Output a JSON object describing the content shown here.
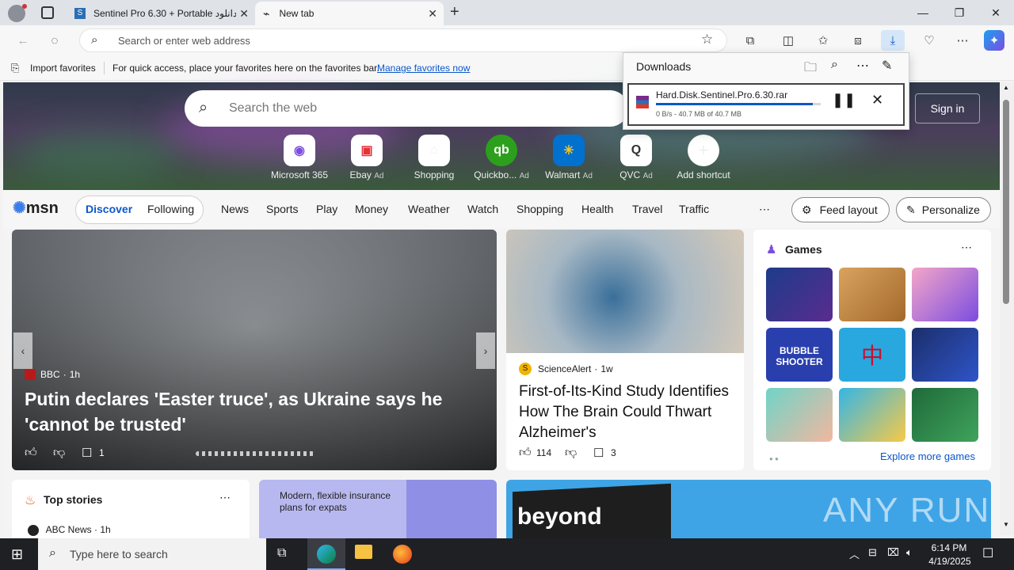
{
  "tabs": [
    {
      "label": "Sentinel Pro 6.30 + Portable دانلود",
      "active": false
    },
    {
      "label": "New tab",
      "active": true
    }
  ],
  "address": {
    "placeholder": "Search or enter web address"
  },
  "favorites_bar": {
    "import_label": "Import favorites",
    "message": "For quick access, place your favorites here on the favorites bar.",
    "manage_link": "Manage favorites now"
  },
  "downloads": {
    "title": "Downloads",
    "file_name": "Hard.Disk.Sentinel.Pro.6.30.rar",
    "status": "0 B/s - 40.7 MB of 40.7 MB",
    "progress": 0.95
  },
  "search": {
    "placeholder": "Search the web"
  },
  "signin_label": "Sign in",
  "shortcuts": [
    {
      "label": "Microsoft 365",
      "ad": ""
    },
    {
      "label": "Ebay",
      "ad": "Ad"
    },
    {
      "label": "Shopping",
      "ad": ""
    },
    {
      "label": "Quickbo...",
      "ad": "Ad"
    },
    {
      "label": "Walmart",
      "ad": "Ad"
    },
    {
      "label": "QVC",
      "ad": "Ad"
    },
    {
      "label": "Add shortcut",
      "ad": ""
    }
  ],
  "msn": {
    "logo": "msn",
    "tabs": [
      "Discover",
      "Following"
    ],
    "nav": [
      "News",
      "Sports",
      "Play",
      "Money",
      "Weather",
      "Watch",
      "Shopping",
      "Health",
      "Travel",
      "Traffic"
    ],
    "more": "⋯",
    "feed_layout": "Feed layout",
    "personalize": "Personalize"
  },
  "hero_story": {
    "source": "BBC",
    "time": "1h",
    "headline": "Putin declares 'Easter truce', as Ukraine says he 'cannot be trusted'",
    "comments": "1"
  },
  "science_story": {
    "source": "ScienceAlert",
    "time": "1w",
    "headline": "First-of-Its-Kind Study Identifies How The Brain Could Thwart Alzheimer's",
    "likes": "114",
    "comments": "3"
  },
  "games": {
    "title": "Games",
    "explore": "Explore more games",
    "tiles": [
      "jewel",
      "wood",
      "makeup",
      "BUBBLE SHOOTER",
      "mahjong",
      "blocks",
      "doctor",
      "crazy",
      "solitaire"
    ]
  },
  "top_stories": {
    "title": "Top stories",
    "source": "ABC News",
    "time": "1h"
  },
  "ad_card": {
    "text": "Modern, flexible insurance plans for expats"
  },
  "beyond_card": {
    "text": "beyond"
  },
  "watermark": "ANY RUN",
  "taskbar": {
    "search_placeholder": "Type here to search",
    "time": "6:14 PM",
    "date": "4/19/2025"
  }
}
